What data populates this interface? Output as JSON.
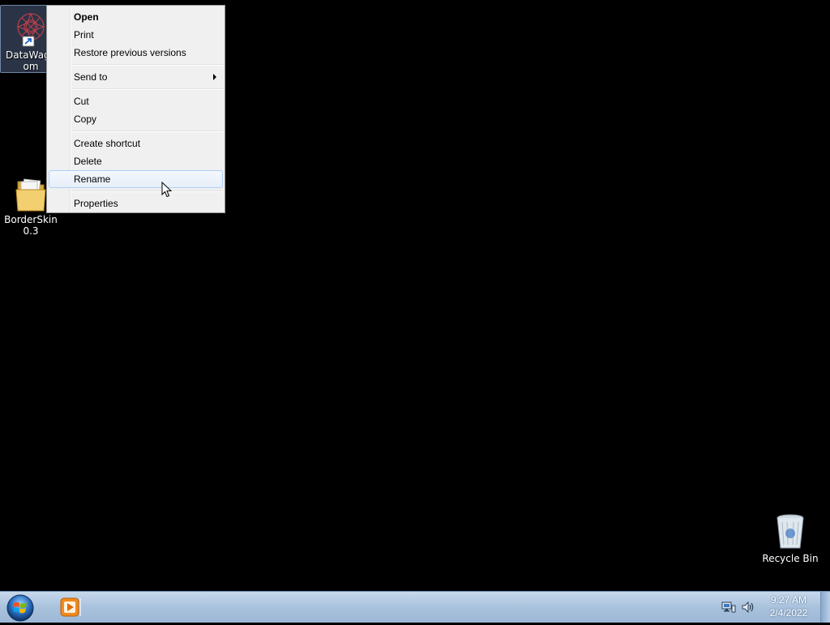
{
  "desktop": {
    "icons": [
      {
        "label_line1": "DataWago",
        "label_line2": "om",
        "icon": "datawagon-app-icon"
      },
      {
        "label_line1": "BorderSkin",
        "label_line2": "0.3",
        "icon": "folder-icon"
      },
      {
        "label_line1": "Recycle Bin",
        "icon": "recycle-bin-icon"
      }
    ]
  },
  "context_menu": {
    "items": [
      {
        "label": "Open",
        "bold": true
      },
      {
        "label": "Print"
      },
      {
        "label": "Restore previous versions"
      },
      {
        "label": "Send to",
        "submenu": true
      },
      {
        "label": "Cut"
      },
      {
        "label": "Copy"
      },
      {
        "label": "Create shortcut"
      },
      {
        "label": "Delete"
      },
      {
        "label": "Rename",
        "highlighted": true
      },
      {
        "label": "Properties"
      }
    ]
  },
  "taskbar": {
    "start_icon": "windows-start-orb-icon",
    "pinned_app_icon": "media-player-icon",
    "tray_icons": [
      "network-icon",
      "speaker-icon"
    ],
    "clock": {
      "time": "9:27 AM",
      "date": "2/4/2022"
    }
  },
  "colors": {
    "menu_bg": "#f0f0f0",
    "highlight_border": "#aecff7",
    "taskbar": "#a9c2dd"
  }
}
